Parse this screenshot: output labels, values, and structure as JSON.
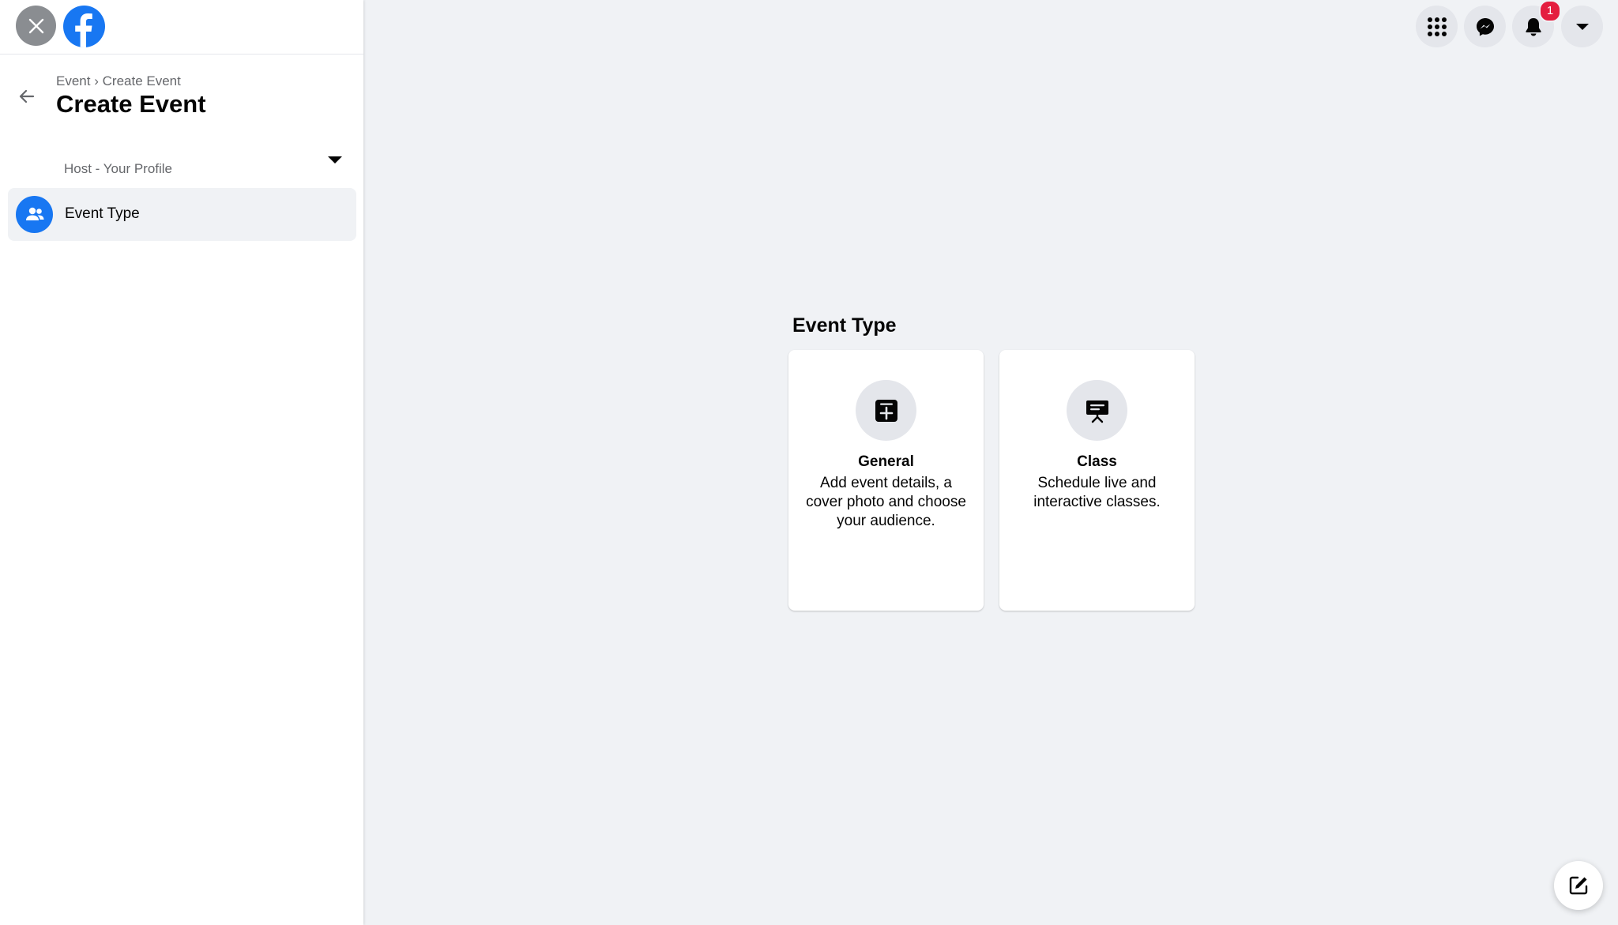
{
  "breadcrumb": {
    "parent": "Event",
    "separator": "›",
    "current": "Create Event"
  },
  "page_title": "Create Event",
  "host": {
    "label": "Host - Your Profile"
  },
  "nav": {
    "items": [
      {
        "label": "Event Type",
        "icon": "people-icon",
        "active": true
      }
    ]
  },
  "topnav": {
    "icons": [
      "menu-grid-icon",
      "messenger-icon",
      "bell-icon",
      "caret-down-icon"
    ],
    "notification_count": "1"
  },
  "main": {
    "section_title": "Event Type",
    "cards": [
      {
        "title": "General",
        "description": "Add event details, a cover photo and choose your audience.",
        "icon": "add-square-icon"
      },
      {
        "title": "Class",
        "description": "Schedule live and interactive classes.",
        "icon": "presentation-icon"
      }
    ]
  },
  "colors": {
    "brand": "#1877F2",
    "background": "#F0F2F5",
    "badge": "#E41E3F"
  }
}
